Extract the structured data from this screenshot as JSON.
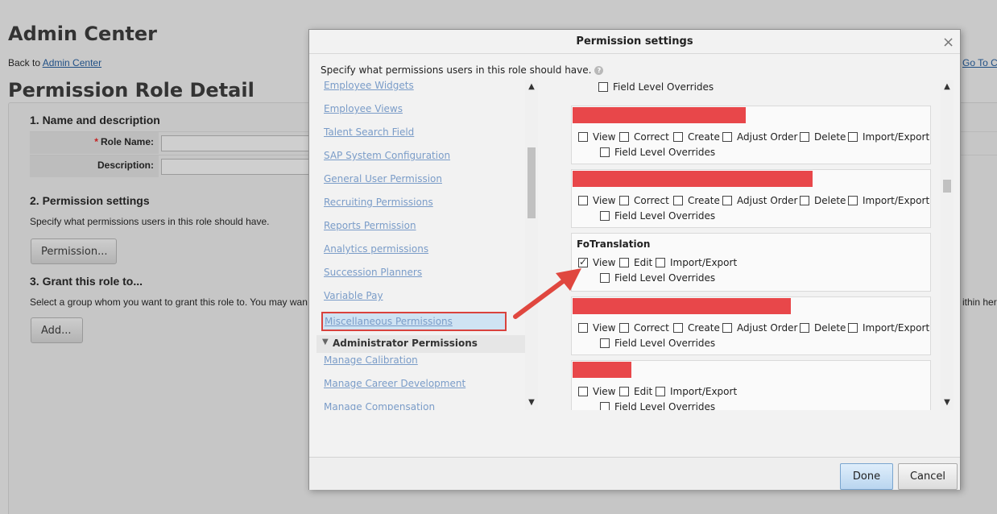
{
  "background": {
    "title": "Admin Center",
    "back_prefix": "Back to ",
    "back_link": "Admin Center",
    "goto_link": "Go To C",
    "page_title": "Permission Role Detail",
    "section1": "1. Name and description",
    "role_name_label": "Role Name:",
    "required_mark": "*",
    "description_label": "Description:",
    "section2": "2. Permission settings",
    "section2_text": "Specify what permissions users in this role should have.",
    "permission_button": "Permission...",
    "section3": "3. Grant this role to...",
    "section3_text": "Select a group whom you want to grant this role to. You may wan",
    "section3_text_right": "ithin her",
    "add_button": "Add..."
  },
  "modal": {
    "title": "Permission settings",
    "close": "×",
    "description": "Specify what permissions users in this role should have.",
    "help": "?",
    "nav": [
      "Employee Widgets",
      "Employee Views",
      "Talent Search Field",
      "SAP System Configuration",
      "General User Permission",
      "Recruiting Permissions",
      "Reports Permission",
      "Analytics permissions",
      "Succession Planners",
      "Variable Pay"
    ],
    "nav_selected": "Miscellaneous Permissions",
    "nav_group": "Administrator Permissions",
    "nav_group_items": [
      "Manage Calibration",
      "Manage Career Development",
      "Manage Compensation"
    ],
    "top_partial_option": "Field Level Overrides",
    "boxes": [
      {
        "title": "",
        "options": [
          "View",
          "Correct",
          "Create",
          "Adjust Order",
          "Delete",
          "Import/Export"
        ],
        "sub_option": "Field Level Overrides"
      },
      {
        "title": "",
        "options": [
          "View",
          "Correct",
          "Create",
          "Adjust Order",
          "Delete",
          "Import/Export"
        ],
        "sub_option": "Field Level Overrides"
      },
      {
        "title": "FoTranslation",
        "options": [
          "View",
          "Edit",
          "Import/Export"
        ],
        "sub_option": "Field Level Overrides"
      },
      {
        "title": "",
        "options": [
          "View",
          "Correct",
          "Create",
          "Adjust Order",
          "Delete",
          "Import/Export"
        ],
        "sub_option": "Field Level Overrides"
      },
      {
        "title": "",
        "options": [
          "View",
          "Edit",
          "Import/Export"
        ],
        "sub_option": "Field Level Overrides"
      }
    ],
    "done_button": "Done",
    "cancel_button": "Cancel"
  },
  "colors": {
    "redaction": "#e8474a",
    "highlight_border": "#d9423d",
    "link": "#7a9cc8",
    "annotation_arrow": "#e0473f"
  }
}
